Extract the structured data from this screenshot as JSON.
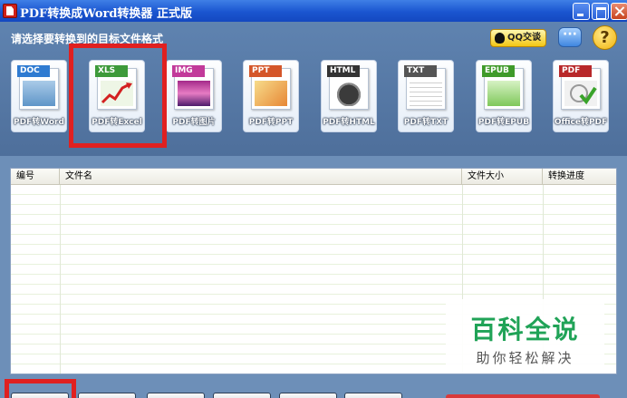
{
  "window": {
    "title": "PDF转换成Word转换器 正式版"
  },
  "header": {
    "prompt": "请选择要转换到的目标文件格式",
    "qq_label": "QQ交谈",
    "help_symbol": "?"
  },
  "formats": [
    {
      "tag": "DOC",
      "label": "PDF转Word",
      "tag_color": "#2f7bd1"
    },
    {
      "tag": "XLS",
      "label": "PDF转Excel",
      "tag_color": "#3d9a3a"
    },
    {
      "tag": "IMG",
      "label": "PDF转图片",
      "tag_color": "#c23a9a"
    },
    {
      "tag": "PPT",
      "label": "PDF转PPT",
      "tag_color": "#d4562a"
    },
    {
      "tag": "HTML",
      "label": "PDF转HTML",
      "tag_color": "#333333"
    },
    {
      "tag": "TXT",
      "label": "PDF转TXT",
      "tag_color": "#555555"
    },
    {
      "tag": "EPUB",
      "label": "PDF转EPUB",
      "tag_color": "#3f9a2a"
    },
    {
      "tag": "PDF",
      "label": "Office转PDF",
      "tag_color": "#b8282a"
    }
  ],
  "table": {
    "columns": [
      "编号",
      "文件名",
      "文件大小",
      "转换进度"
    ]
  },
  "watermark": {
    "title": "百科全说",
    "subtitle": "助你轻松解决"
  },
  "colors": {
    "titlebar": "#1a55d0",
    "header_bg": "#5f83b0",
    "highlight": "#e02020",
    "watermark": "#20a357"
  }
}
